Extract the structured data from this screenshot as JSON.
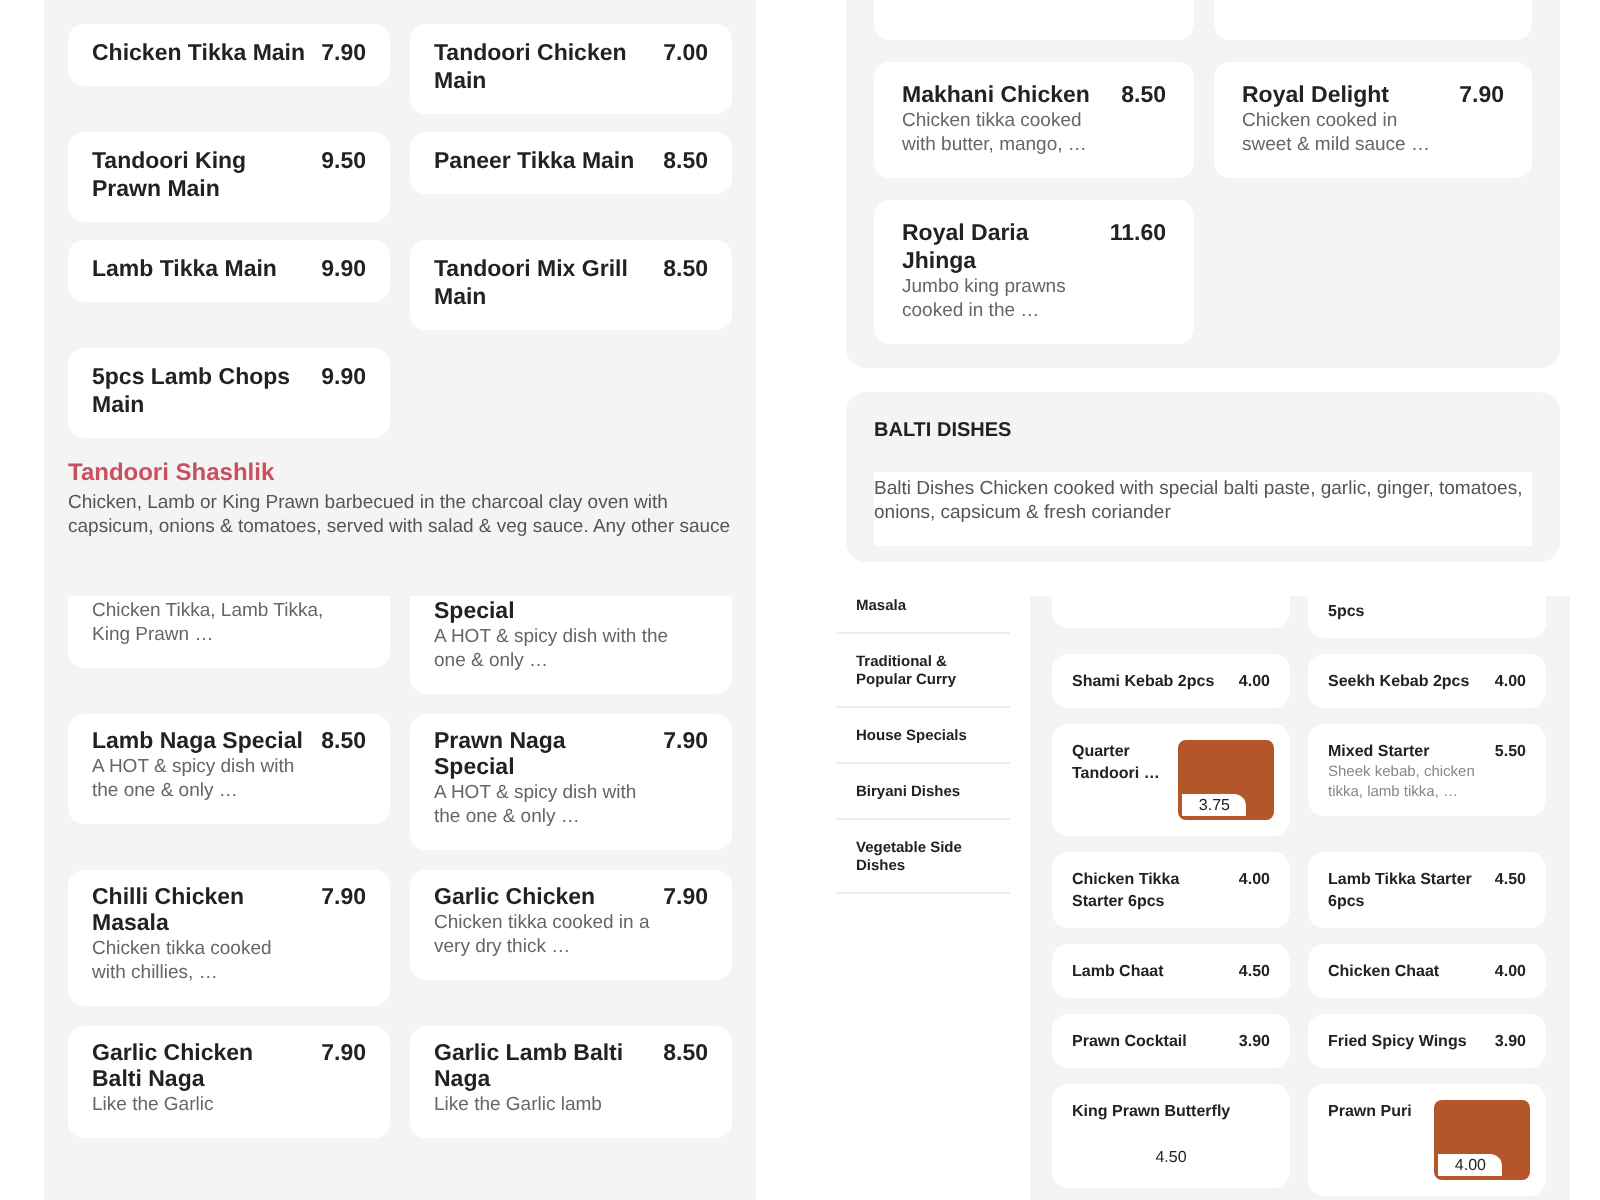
{
  "tandoori_mains": {
    "items": [
      {
        "kind": "text",
        "name": "Chicken Tikka Main",
        "price": "7.90"
      },
      {
        "kind": "text",
        "name": "Tandoori Chicken Main",
        "price": "7.00"
      },
      {
        "kind": "text",
        "name": "Tandoori King Prawn Main",
        "price": "9.50"
      },
      {
        "kind": "text",
        "name": "Paneer Tikka Main",
        "price": "8.50"
      },
      {
        "kind": "text",
        "name": "Lamb Tikka Main",
        "price": "9.90"
      },
      {
        "kind": "text",
        "name": "Tandoori Mix Grill Main",
        "price": "8.50"
      },
      {
        "kind": "text",
        "name": "5pcs Lamb Chops Main",
        "price": "9.90"
      }
    ],
    "next_section": {
      "title": "Tandoori Shashlik",
      "description": "Chicken, Lamb or King Prawn barbecued in the charcoal clay oven with capsicum, onions & tomatoes, served with salad & veg sauce. Any other sauce"
    }
  },
  "house_specials": {
    "items": [
      {
        "kind": "fragment"
      },
      {
        "kind": "fragment"
      },
      {
        "kind": "text",
        "name": "Makhani Chicken",
        "price": "8.50",
        "description": "Chicken tikka cooked with butter, mango, …"
      },
      {
        "kind": "text",
        "name": "Royal Delight",
        "price": "7.90",
        "description": "Chicken cooked in sweet & mild sauce …"
      },
      {
        "kind": "text",
        "name": "Royal Daria Jhinga",
        "price": "11.60",
        "description": "Jumbo king prawns cooked in the …"
      }
    ]
  },
  "balti_dishes": {
    "title": "BALTI DISHES",
    "description": "Balti Dishes Chicken cooked with special balti paste, garlic, ginger, tomatoes, onions, capsicum & fresh coriander"
  },
  "naga_dishes": {
    "items": [
      {
        "kind": "text",
        "description": "Chicken Tikka, Lamb Tikka, King Prawn …"
      },
      {
        "kind": "text",
        "name": "Special",
        "description": "A HOT & spicy dish with the one & only …"
      },
      {
        "kind": "text",
        "name": "Lamb Naga Special",
        "price": "8.50",
        "description": "A HOT & spicy dish with the one & only …"
      },
      {
        "kind": "text",
        "name": "Prawn Naga Special",
        "price": "7.90",
        "description": "A HOT & spicy dish with the one & only …"
      },
      {
        "kind": "text",
        "name": "Chilli Chicken Masala",
        "price": "7.90",
        "description": "Chicken tikka cooked with chillies, …"
      },
      {
        "kind": "text",
        "name": "Garlic Chicken",
        "price": "7.90",
        "description": "Chicken tikka cooked in a very dry thick …"
      },
      {
        "kind": "text",
        "name": "Garlic Chicken Balti Naga",
        "price": "7.90",
        "description": "Like the Garlic"
      },
      {
        "kind": "text",
        "name": "Garlic Lamb Balti Naga",
        "price": "8.50",
        "description": "Like the Garlic lamb"
      }
    ]
  },
  "categories": [
    "Masala",
    "Traditional & Popular Curry",
    "House Specials",
    "Biryani Dishes",
    "Vegetable Side Dishes"
  ],
  "starters": {
    "items": [
      {
        "kind": "fragment"
      },
      {
        "kind": "text",
        "name": "5pcs"
      },
      {
        "kind": "text",
        "name": "Shami Kebab 2pcs",
        "price": "4.00"
      },
      {
        "kind": "text",
        "name": "Seekh Kebab 2pcs",
        "price": "4.00"
      },
      {
        "kind": "photo",
        "name": "Quarter Tandoori …",
        "price": "3.75"
      },
      {
        "kind": "text",
        "name": "Mixed Starter",
        "price": "5.50",
        "description": "Sheek kebab, chicken tikka, lamb tikka, …"
      },
      {
        "kind": "text",
        "name": "Chicken Tikka Starter 6pcs",
        "price": "4.00"
      },
      {
        "kind": "text",
        "name": "Lamb Tikka Starter 6pcs",
        "price": "4.50"
      },
      {
        "kind": "text",
        "name": "Lamb Chaat",
        "price": "4.50"
      },
      {
        "kind": "text",
        "name": "Chicken Chaat",
        "price": "4.00"
      },
      {
        "kind": "text",
        "name": "Prawn Cocktail",
        "price": "3.90"
      },
      {
        "kind": "text",
        "name": "Fried Spicy Wings",
        "price": "3.90"
      },
      {
        "kind": "price_below",
        "name": "King Prawn Butterfly",
        "price": "4.50"
      },
      {
        "kind": "photo",
        "name": "Prawn Puri",
        "price": "4.00"
      }
    ]
  }
}
